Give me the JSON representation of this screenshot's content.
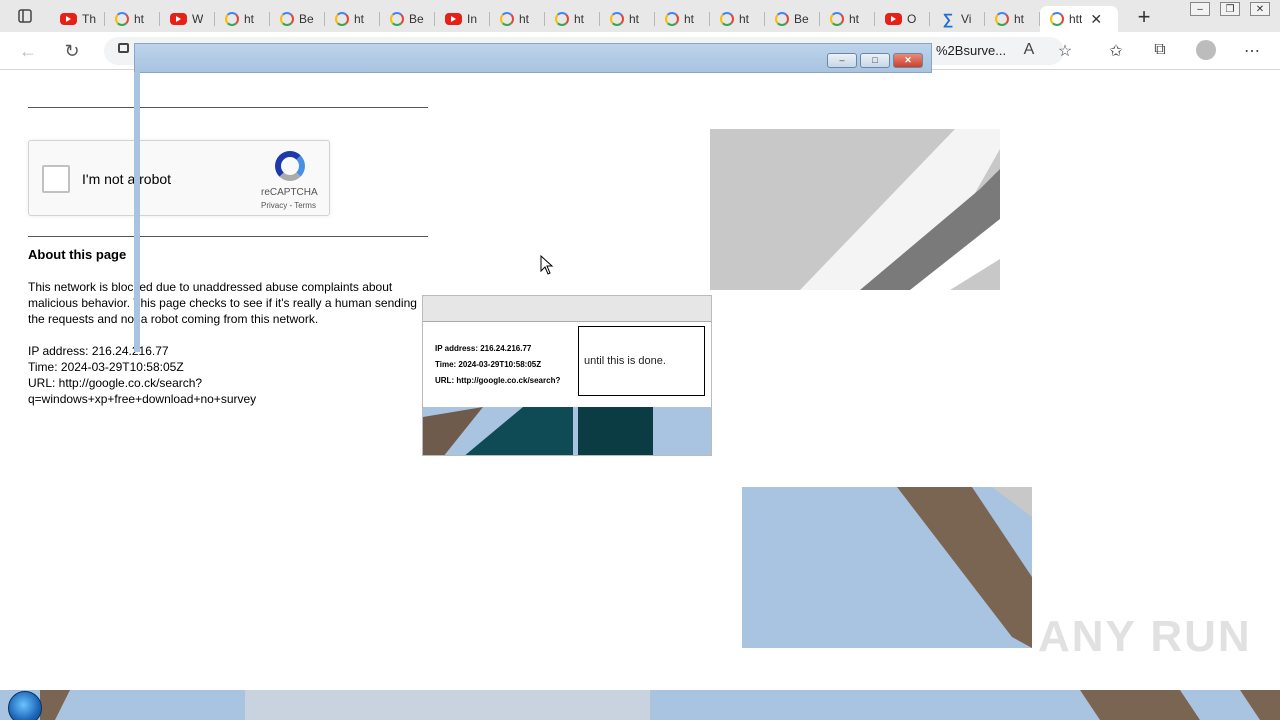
{
  "browser": {
    "tabs": [
      {
        "icon": "youtube-icon",
        "label": "Th"
      },
      {
        "icon": "google-icon",
        "label": "ht"
      },
      {
        "icon": "youtube-icon",
        "label": "W"
      },
      {
        "icon": "google-icon",
        "label": "ht"
      },
      {
        "icon": "google-icon",
        "label": "Be"
      },
      {
        "icon": "google-icon",
        "label": "ht"
      },
      {
        "icon": "google-icon",
        "label": "Be"
      },
      {
        "icon": "youtube-icon",
        "label": "In"
      },
      {
        "icon": "google-icon",
        "label": "ht"
      },
      {
        "icon": "google-icon",
        "label": "ht"
      },
      {
        "icon": "google-icon",
        "label": "ht"
      },
      {
        "icon": "google-icon",
        "label": "ht"
      },
      {
        "icon": "google-icon",
        "label": "ht"
      },
      {
        "icon": "google-icon",
        "label": "Be"
      },
      {
        "icon": "google-icon",
        "label": "ht"
      },
      {
        "icon": "youtube-icon",
        "label": "O"
      },
      {
        "icon": "ms-icon",
        "label": "Vi"
      },
      {
        "icon": "google-icon",
        "label": "ht"
      }
    ],
    "active_tab_label": "htt",
    "new_tab_label": "+",
    "url_tail": "%2Bsurve..."
  },
  "recaptcha": {
    "label": "I'm not a robot",
    "brand": "reCAPTCHA",
    "links": "Privacy - Terms"
  },
  "content": {
    "heading": "About this page",
    "paragraph": "This network is blocked due to unaddressed abuse complaints about malicious behavior. This page checks to see if it's really a human sending the requests and not a robot coming from this network.",
    "ip_line": "IP address: 216.24.216.77",
    "time_line": "Time: 2024-03-29T10:58:05Z",
    "url_line": "URL: http://google.co.ck/search?",
    "url_line2": "q=windows+xp+free+download+no+survey"
  },
  "thumbnail": {
    "line1": "IP address: 216.24.216.77",
    "line2": "Time: 2024-03-29T10:58:05Z",
    "line3": "URL: http://google.co.ck/search?",
    "message": "until this is done."
  },
  "watermark": "ANY RUN",
  "colors": {
    "accent_blue": "#a9c4e0",
    "recaptcha_blue": "#1c3aa9"
  }
}
